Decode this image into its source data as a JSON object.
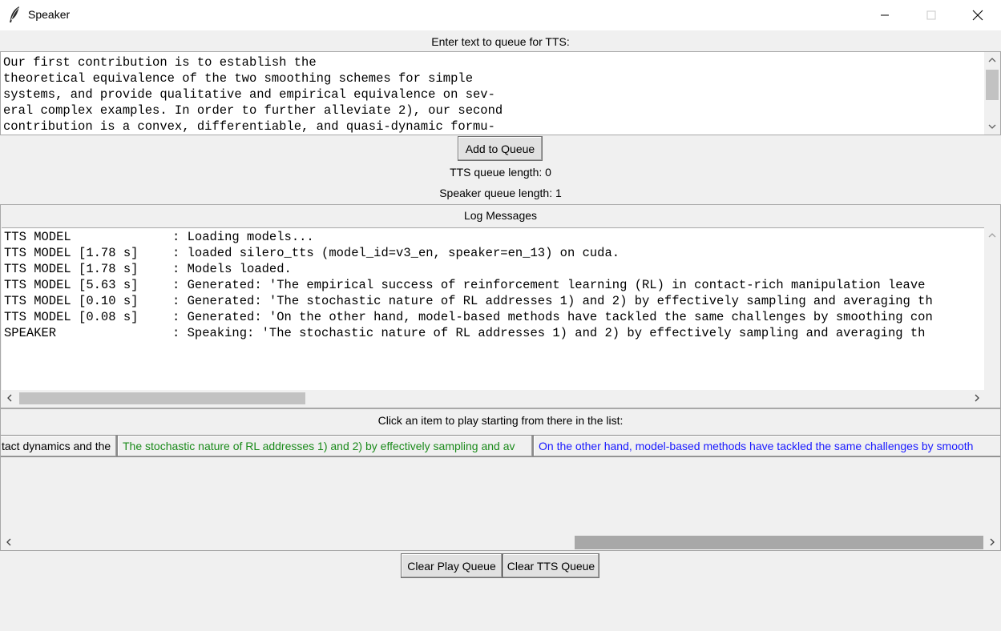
{
  "window": {
    "title": "Speaker",
    "minimize_glyph": "—",
    "maximize_glyph": "☐",
    "close_glyph": "✕"
  },
  "entry": {
    "label": "Enter text to queue for TTS:",
    "text": "Our first contribution is to establish the\ntheoretical equivalence of the two smoothing schemes for simple\nsystems, and provide qualitative and empirical equivalence on sev-\neral complex examples. In order to further alleviate 2), our second\ncontribution is a convex, differentiable, and quasi-dynamic formu-"
  },
  "buttons": {
    "add_to_queue": "Add to Queue",
    "clear_play_queue": "Clear Play Queue",
    "clear_tts_queue": "Clear TTS Queue"
  },
  "status": {
    "tts_queue": "TTS queue length: 0",
    "speaker_queue": "Speaker queue length: 1"
  },
  "log": {
    "title": "Log Messages",
    "lines": [
      {
        "source": "TTS MODEL",
        "message": ": Loading models..."
      },
      {
        "source": "TTS MODEL [1.78 s]",
        "message": ": loaded silero_tts (model_id=v3_en, speaker=en_13) on cuda."
      },
      {
        "source": "TTS MODEL [1.78 s]",
        "message": ": Models loaded."
      },
      {
        "source": "TTS MODEL [5.63 s]",
        "message": ": Generated: 'The empirical success of reinforcement learning (RL) in contact-rich manipulation leave"
      },
      {
        "source": "TTS MODEL [0.10 s]",
        "message": ": Generated: 'The stochastic nature of RL addresses 1) and 2) by effectively sampling and averaging th"
      },
      {
        "source": "TTS MODEL [0.08 s]",
        "message": ": Generated: 'On the other hand, model-based methods have tackled the same challenges by smoothing con"
      },
      {
        "source": "SPEAKER",
        "message": ": Speaking: 'The stochastic nature of RL addresses 1) and 2) by effectively sampling and averaging th"
      }
    ]
  },
  "playlist": {
    "label": "Click an item to play starting from there in the list:",
    "items": [
      {
        "text": "tact dynamics and the",
        "color": "#000000"
      },
      {
        "text": "The stochastic nature of RL addresses 1) and 2) by effectively sampling and av",
        "color": "#1a8a1a"
      },
      {
        "text": "On the other hand, model-based methods have tackled the same challenges by smooth",
        "color": "#1a1aff"
      }
    ]
  },
  "scroll": {
    "up": "^",
    "down": "v",
    "left": "<",
    "right": ">"
  }
}
